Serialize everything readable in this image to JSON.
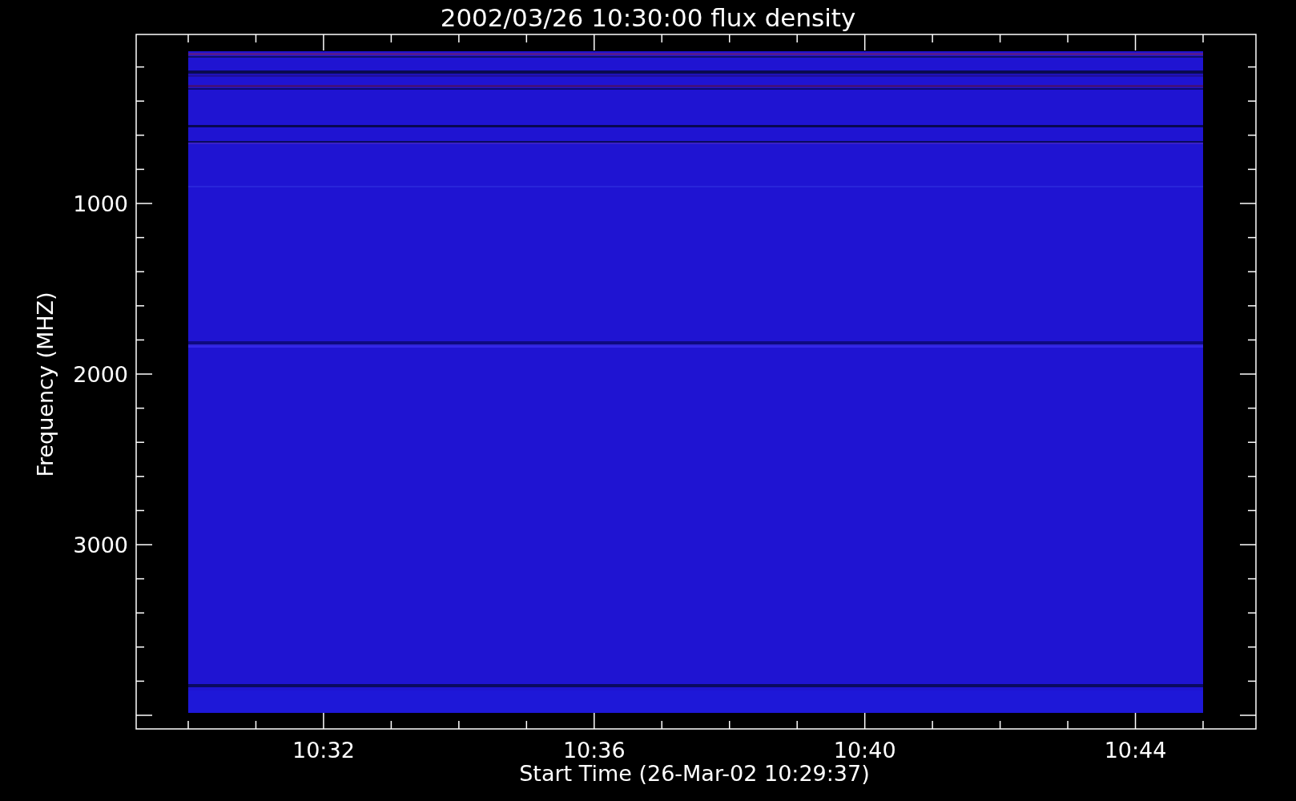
{
  "plot": {
    "title": "2002/03/26 10:30:00 flux density",
    "ylabel": "Frequency (MHZ)",
    "xlabel": "Start Time (26-Mar-02 10:29:37)",
    "yticks": [
      "1000",
      "2000",
      "3000"
    ],
    "xticks": [
      "10:32",
      "10:36",
      "10:40",
      "10:44"
    ]
  }
}
